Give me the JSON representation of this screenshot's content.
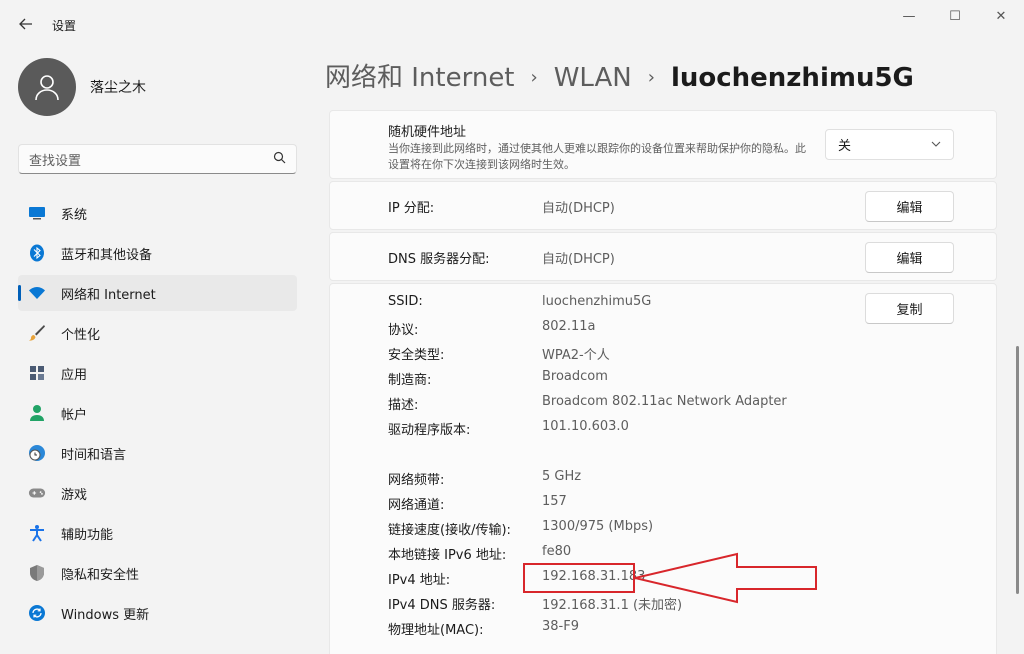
{
  "window": {
    "title": "设置",
    "back_icon": "back-arrow-icon",
    "minimize": "—",
    "maximize": "☐",
    "close": "✕"
  },
  "profile": {
    "name": "落尘之木"
  },
  "search": {
    "placeholder": "查找设置",
    "icon": "search-icon"
  },
  "nav": [
    {
      "label": "系统",
      "icon": "display-icon",
      "color": "#0067c0"
    },
    {
      "label": "蓝牙和其他设备",
      "icon": "bluetooth-icon",
      "color": "#0067c0"
    },
    {
      "label": "网络和 Internet",
      "icon": "wifi-icon",
      "color": "#0067c0",
      "active": true
    },
    {
      "label": "个性化",
      "icon": "brush-icon",
      "color": "#e8a33a"
    },
    {
      "label": "应用",
      "icon": "apps-icon",
      "color": "#4a5a73"
    },
    {
      "label": "帐户",
      "icon": "account-icon",
      "color": "#21a366"
    },
    {
      "label": "时间和语言",
      "icon": "globe-clock-icon",
      "color": "#2b88d8"
    },
    {
      "label": "游戏",
      "icon": "gamepad-icon",
      "color": "#8a8a8a"
    },
    {
      "label": "辅助功能",
      "icon": "accessibility-icon",
      "color": "#1a73e8"
    },
    {
      "label": "隐私和安全性",
      "icon": "shield-icon",
      "color": "#7a7a7a"
    },
    {
      "label": "Windows 更新",
      "icon": "update-icon",
      "color": "#0067c0"
    }
  ],
  "breadcrumb": {
    "items": [
      "网络和 Internet",
      "WLAN",
      "luochenzhimu5G"
    ],
    "separator": "›"
  },
  "random_mac": {
    "title": "随机硬件地址",
    "description": "当你连接到此网络时，通过使其他人更难以跟踪你的设备位置来帮助保护你的隐私。此设置将在你下次连接到该网络时生效。",
    "value": "关"
  },
  "ip_assignment": {
    "label": "IP 分配:",
    "value": "自动(DHCP)",
    "button": "编辑"
  },
  "dns_assignment": {
    "label": "DNS 服务器分配:",
    "value": "自动(DHCP)",
    "button": "编辑"
  },
  "properties": {
    "copy_button": "复制",
    "group1": [
      {
        "label": "SSID:",
        "value": "luochenzhimu5G"
      },
      {
        "label": "协议:",
        "value": "802.11a"
      },
      {
        "label": "安全类型:",
        "value": "WPA2-个人"
      },
      {
        "label": "制造商:",
        "value": "Broadcom"
      },
      {
        "label": "描述:",
        "value": "Broadcom 802.11ac Network Adapter"
      },
      {
        "label": "驱动程序版本:",
        "value": "101.10.603.0"
      }
    ],
    "group2": [
      {
        "label": "网络频带:",
        "value": "5 GHz"
      },
      {
        "label": "网络通道:",
        "value": "157"
      },
      {
        "label": "链接速度(接收/传输):",
        "value": "1300/975 (Mbps)"
      },
      {
        "label": "本地链接 IPv6 地址:",
        "value": "fe80"
      },
      {
        "label": "IPv4 地址:",
        "value": "192.168.31.183"
      },
      {
        "label": "IPv4 DNS 服务器:",
        "value": "192.168.31.1 (未加密)"
      },
      {
        "label": "物理地址(MAC):",
        "value": "38-F9"
      }
    ]
  },
  "annotation": {
    "color": "#d8262b"
  }
}
